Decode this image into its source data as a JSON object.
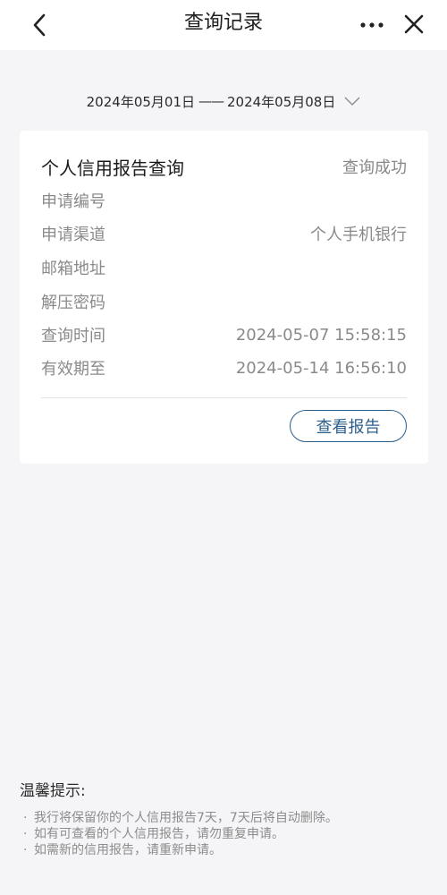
{
  "header": {
    "title": "查询记录",
    "back_icon": "chevron-left-icon",
    "more_icon": "more-dots-icon",
    "close_icon": "close-icon"
  },
  "date_filter": {
    "start": "2024年05月01日",
    "separator": "——",
    "end": "2024年05月08日",
    "icon": "chevron-down-icon"
  },
  "record": {
    "title": "个人信用报告查询",
    "status": "查询成功",
    "fields": [
      {
        "label": "申请编号",
        "value": ""
      },
      {
        "label": "申请渠道",
        "value": "个人手机银行"
      },
      {
        "label": "邮箱地址",
        "value": ""
      },
      {
        "label": "解压密码",
        "value": ""
      },
      {
        "label": "查询时间",
        "value": "2024-05-07 15:58:15"
      },
      {
        "label": "有效期至",
        "value": "2024-05-14 16:56:10"
      }
    ],
    "view_button": "查看报告"
  },
  "tips": {
    "title": "温馨提示:",
    "items": [
      "我行将保留你的个人信用报告7天，7天后将自动删除。",
      "如有可查看的个人信用报告，请勿重复申请。",
      "如需新的信用报告，请重新申请。"
    ]
  },
  "colors": {
    "accent": "#2d5f8b",
    "background": "#f5f5f7",
    "card": "#ffffff",
    "muted_text": "#8a8a8a"
  }
}
